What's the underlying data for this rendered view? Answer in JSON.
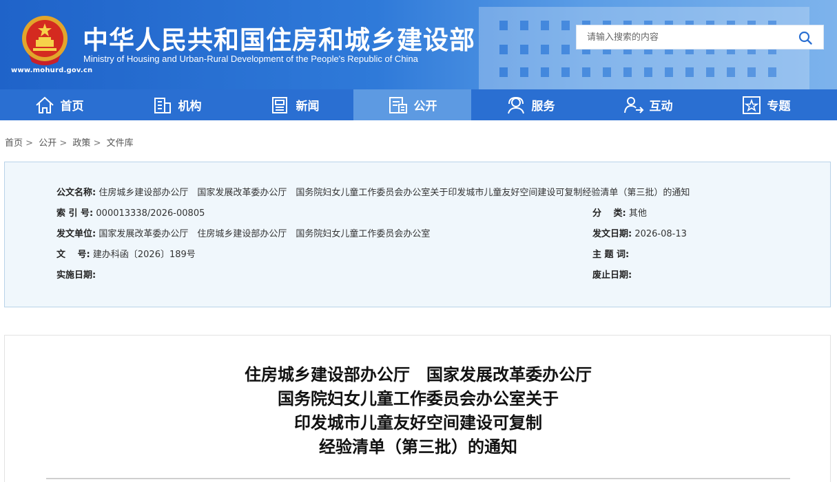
{
  "header": {
    "title": "中华人民共和国住房和城乡建设部",
    "subtitle": "Ministry of Housing and Urban-Rural Development of the People's Republic of China",
    "site_url": "www.mohurd.gov.cn",
    "search_placeholder": "请输入搜索的内容"
  },
  "nav": {
    "items": [
      {
        "label": "首页",
        "icon": "home-icon"
      },
      {
        "label": "机构",
        "icon": "building-icon"
      },
      {
        "label": "新闻",
        "icon": "news-icon"
      },
      {
        "label": "公开",
        "icon": "public-docs-icon"
      },
      {
        "label": "服务",
        "icon": "service-icon"
      },
      {
        "label": "互动",
        "icon": "interaction-icon"
      },
      {
        "label": "专题",
        "icon": "topic-star-icon"
      }
    ],
    "active": "公开"
  },
  "breadcrumb": [
    "首页",
    "公开",
    "政策",
    "文件库"
  ],
  "breadcrumb_separator": ">",
  "meta": {
    "title_label": "公文名称:",
    "title_value": "住房城乡建设部办公厅　国家发展改革委办公厅　国务院妇女儿童工作委员会办公室关于印发城市儿童友好空间建设可复制经验清单（第三批）的通知",
    "index_label": "索 引 号:",
    "index_value": "000013338/2026-00805",
    "category_label": "分　 类:",
    "category_value": "其他",
    "issuer_label": "发文单位:",
    "issuer_value": "国家发展改革委办公厅　住房城乡建设部办公厅　国务院妇女儿童工作委员会办公室",
    "date_label": "发文日期:",
    "date_value": "2026-08-13",
    "docno_label": "文　 号:",
    "docno_value": "建办科函〔2026〕189号",
    "keywords_label": "主 题 词:",
    "keywords_value": "",
    "effective_label": "实施日期:",
    "effective_value": "",
    "expiry_label": "废止日期:",
    "expiry_value": ""
  },
  "document": {
    "title_lines": [
      "住房城乡建设部办公厅　国家发展改革委办公厅",
      "国务院妇女儿童工作委员会办公室关于",
      "印发城市儿童友好空间建设可复制",
      "经验清单（第三批）的通知"
    ]
  },
  "colors": {
    "header_blue": "#1f63c9",
    "nav_blue": "#2a6fd2",
    "nav_active": "#5d9ae2",
    "meta_bg": "#f0f7fc",
    "meta_border": "#b8d2e8"
  }
}
